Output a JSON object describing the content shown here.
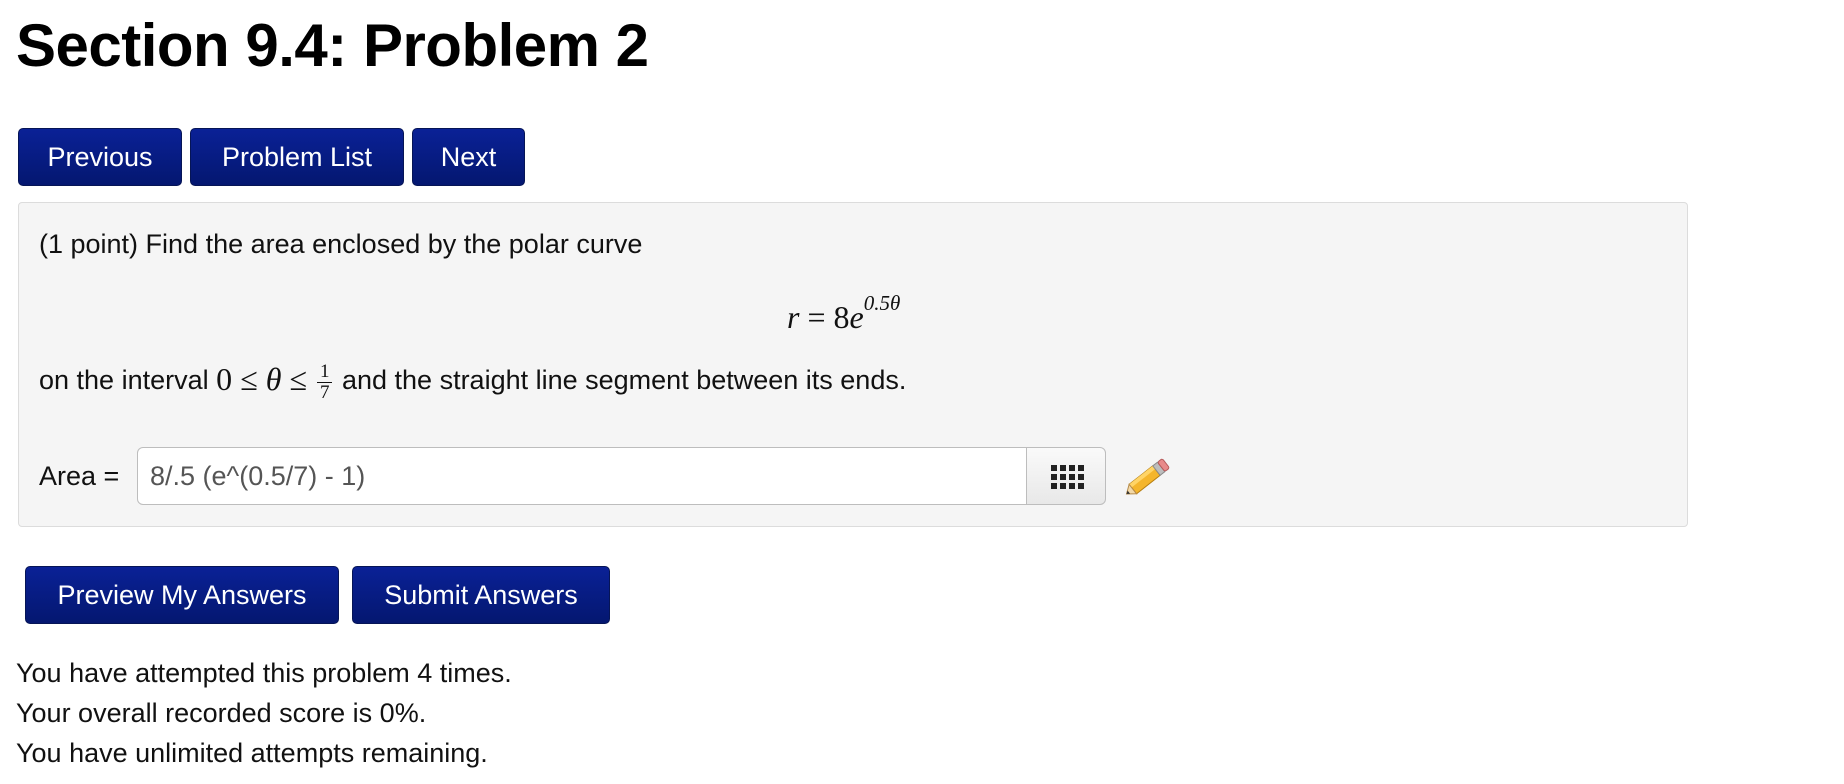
{
  "page": {
    "title": "Section 9.4: Problem 2"
  },
  "nav": {
    "previous_label": "Previous",
    "problem_list_label": "Problem List",
    "next_label": "Next"
  },
  "problem": {
    "intro": "(1 point) Find the area enclosed by the polar curve",
    "equation": {
      "lhs": "r",
      "eq": "=",
      "coef": "8",
      "base": "e",
      "exponent": "0.5θ"
    },
    "interval_prefix": "on the interval",
    "interval": {
      "lower": "0",
      "le1": "≤",
      "var": "θ",
      "le2": "≤",
      "frac_num": "1",
      "frac_den": "7"
    },
    "interval_suffix": "and the straight line segment between its ends.",
    "answer_label": "Area =",
    "answer_value": "8/.5 (e^(0.5/7) - 1)"
  },
  "actions": {
    "preview_label": "Preview My Answers",
    "submit_label": "Submit Answers"
  },
  "status": {
    "attempts": "You have attempted this problem 4 times.",
    "score": "Your overall recorded score is 0%.",
    "remaining": "You have unlimited attempts remaining."
  },
  "icons": {
    "keypad": "keypad-icon",
    "pencil": "pencil-icon"
  },
  "colors": {
    "button_bg": "#0a2196",
    "problem_bg": "#f5f5f5"
  }
}
